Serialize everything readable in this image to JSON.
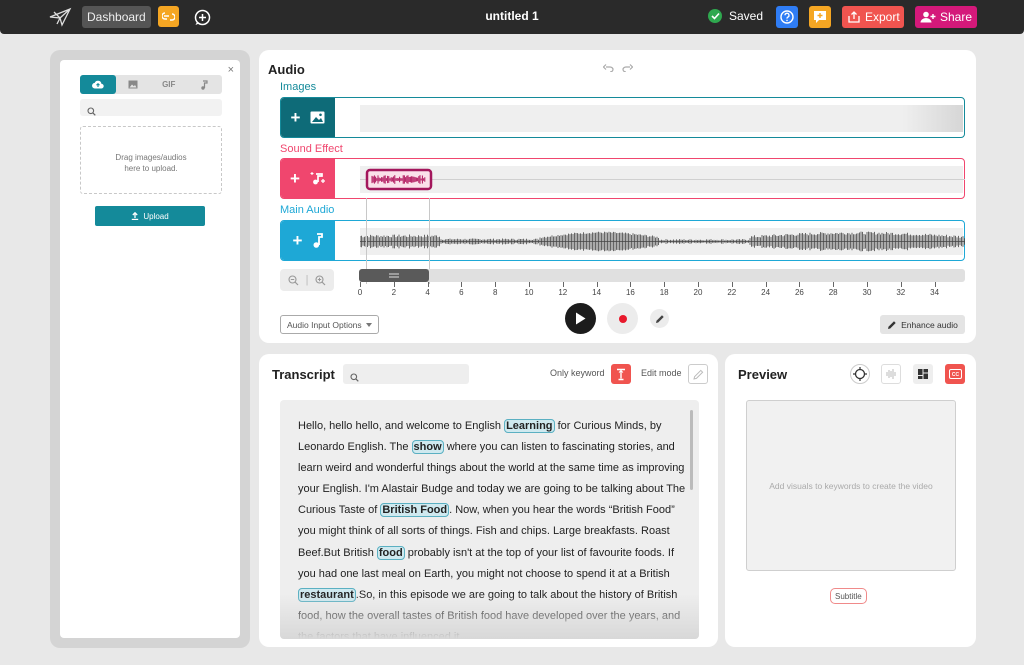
{
  "header": {
    "dashboard_label": "Dashboard",
    "doc_title": "untitled 1",
    "saved_label": "Saved",
    "export_label": "Export",
    "share_label": "Share"
  },
  "media_panel": {
    "close_symbol": "×",
    "tabs": [
      {
        "name": "upload",
        "icon": "cloud-upload-icon"
      },
      {
        "name": "images",
        "icon": "image-icon"
      },
      {
        "name": "gif",
        "label": "GIF"
      },
      {
        "name": "audio",
        "icon": "music-note-icon"
      }
    ],
    "search_placeholder": "",
    "dropzone_line1": "Drag images/audios",
    "dropzone_line2": "here to upload.",
    "upload_label": "Upload"
  },
  "audio": {
    "title": "Audio",
    "tracks": {
      "images": {
        "label": "Images",
        "color": "#0e6b78"
      },
      "sound_effect": {
        "label": "Sound Effect",
        "color": "#f0466e"
      },
      "main_audio": {
        "label": "Main Audio",
        "color": "#1ea8d6"
      }
    },
    "ruler_ticks": [
      "0",
      "2",
      "4",
      "6",
      "8",
      "10",
      "12",
      "14",
      "16",
      "18",
      "20",
      "22",
      "24",
      "26",
      "28",
      "30",
      "32",
      "34"
    ],
    "audio_input_label": "Audio Input Options",
    "enhance_label": "Enhance audio"
  },
  "transcript": {
    "title": "Transcript",
    "search_placeholder": "",
    "only_keyword_label": "Only keyword",
    "edit_mode_label": "Edit mode",
    "segments": [
      {
        "t": "Hello, hello hello, and welcome to English "
      },
      {
        "k": "Learning"
      },
      {
        "t": " for Curious Minds, by Leonardo English. The "
      },
      {
        "k": "show"
      },
      {
        "t": " where you can listen to fascinating stories, and learn weird and wonderful things about the world at the same time as improving your English. I'm Alastair Budge and today we are going to be talking about The Curious Taste of "
      },
      {
        "k": "British Food"
      },
      {
        "t": ". Now, when you hear the words “British Food” you might think of all sorts of things. Fish and chips. Large breakfasts. Roast Beef.But British "
      },
      {
        "k": "food"
      },
      {
        "t": " probably isn't at the top of your list of favourite foods. If you had one last meal on Earth, you might not choose to spend it at a British "
      },
      {
        "k": "restaurant"
      },
      {
        "t": ".So, in this episode we are going to talk about the history of British food, how the overall tastes of British food have developed over the years, and the factors that have influenced it"
      }
    ]
  },
  "preview": {
    "title": "Preview",
    "placeholder": "Add  visuals to keywords to create the video",
    "subtitle_label": "Subtitle",
    "cc_label": "CC"
  }
}
